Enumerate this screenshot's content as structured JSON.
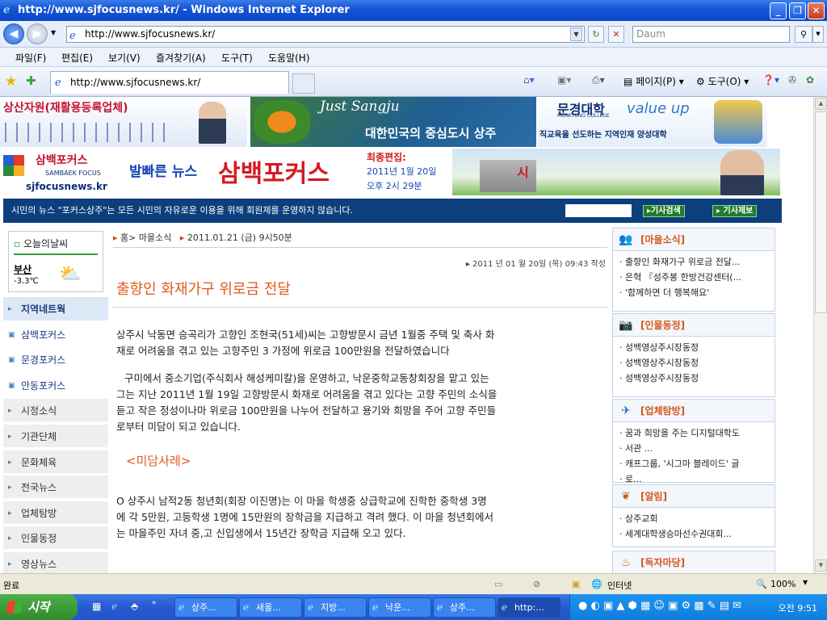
{
  "window": {
    "title": "http://www.sjfocusnews.kr/ - Windows Internet Explorer"
  },
  "address": {
    "url": "http://www.sjfocusnews.kr/",
    "search_placeholder": "Daum"
  },
  "menu": [
    "파일(F)",
    "편집(E)",
    "보기(V)",
    "즐겨찾기(A)",
    "도구(T)",
    "도움말(H)"
  ],
  "tab": {
    "label": "http://www.sjfocusnews.kr/"
  },
  "commands": {
    "page": "페이지(P)",
    "tools": "도구(O)"
  },
  "banners": {
    "ad1": "상산자원(재활용등록업체)",
    "ad2_title": "Just Sangju",
    "ad2_sub": "대한민국의 중심도시 상주",
    "ad3_school": "문경대학",
    "ad3_school_en": "MUNKYUNG COLLEGE",
    "ad3_slogan": "value up",
    "ad3_tagline": "직교육을 선도하는 지역인재 양성대학"
  },
  "header": {
    "logo_kr": "삼백포커스",
    "logo_en": "SAMBAEK FOCUS",
    "logo_url": "sjfocusnews.kr",
    "slogan_small": "발빠른 뉴스",
    "slogan_big": "삼백포커스",
    "edited_label": "최종편집:",
    "edited_date": "2011년 1월 20일",
    "edited_time": "오후 2시 29분",
    "image_caption": "시"
  },
  "notice": {
    "text": "시민의 뉴스 \"포커스상주\"는 모든 시민의 자유로운 이용을 위해 회원제를 운영하지 않습니다.",
    "search_button": "기사검색",
    "report_button": "기사제보"
  },
  "weather": {
    "title": "오늘의날씨",
    "city": "부산",
    "temp": "-3.3℃"
  },
  "left_nav": [
    {
      "label": "지역네트웍",
      "style": "blue"
    },
    {
      "label": "삼백포커스",
      "style": "sub"
    },
    {
      "label": "문경포커스",
      "style": "sub"
    },
    {
      "label": "안동포커스",
      "style": "sub"
    },
    {
      "label": "시정소식",
      "style": "gray"
    },
    {
      "label": "기관단체",
      "style": "gray"
    },
    {
      "label": "문화체육",
      "style": "gray"
    },
    {
      "label": "전국뉴스",
      "style": "gray"
    },
    {
      "label": "업체탐방",
      "style": "gray"
    },
    {
      "label": "인물동정",
      "style": "gray"
    },
    {
      "label": "영상뉴스",
      "style": "gray"
    }
  ],
  "article": {
    "breadcrumb": "홈> 마을소식",
    "breadcrumb_date": "2011.01.21 (금) 9시50분",
    "written": "2011 년 01 월 20일 (목) 09:43 작성",
    "title": "출향인 화재가구 위로금 전달",
    "p1_l1": "상주시 낙동면 승곡리가 고향인 조현국(51세)씨는 고향방문시 금년 1월중 주택 및 축사 화",
    "p1_l2": "재로 어려움을 겪고 있는 고향주민 3 가정에 위로금 100만원을 전달하였습니다",
    "p2_l1": "구미에서 중소기업(주식회사 해성케미칼)을 운영하고, 낙운중학교동창회장을 맡고 있는",
    "p2_l2": "그는 지난 2011년 1월 19일 고향방문시 화재로 어려움을 겪고 있다는 고향 주민의 소식을",
    "p2_l3": "듣고 작은 정성이나마 위로금 100만원을 나누어 전달하고 용기와 희망을 주어 고향 주민들",
    "p2_l4": "로부터 미담이 되고 있습니다.",
    "subhead": "<미담사례>",
    "p3_l1": "O 상주시 남적2동 청년회(회장 이진명)는 이 마을 학생중 상급학교에 진학한 중학생 3명",
    "p3_l2": "에 각 5만원, 고등학생 1명에 15만원의 장학금을 지급하고 격려 했다. 이 마을 청년회에서",
    "p3_l3": "는 마을주민 자녀 중,고 신입생에서 15년간 장학금 지급해 오고 있다."
  },
  "right": {
    "village": {
      "title": "[마을소식]",
      "items": [
        "출향인 화재가구 위로금 전달...",
        "은혁 『성주봉 한방건강센터(...",
        "'함께하면 더 행복해요'"
      ]
    },
    "people": {
      "title": "[인물동정]",
      "items": [
        "성백영상주시장동정",
        "성백영상주시장동정",
        "성백영상주시장동정"
      ]
    },
    "company": {
      "title": "[업체탐방]",
      "items": [
        "꿈과 희망을 주는 디지털대학도",
        "서관 ...",
        "캐프그룹, '시그마 블레이드' 글",
        "로..."
      ]
    },
    "notice": {
      "title": "[알림]",
      "items": [
        "상주교회",
        "세계대학생승마선수권대회..."
      ]
    },
    "reader": {
      "title": "[독자마당]"
    }
  },
  "status": {
    "left": "완료",
    "zone": "인터넷",
    "zoom": "100%"
  },
  "taskbar": {
    "start": "시작",
    "tasks": [
      "상주...",
      "새올...",
      "지방...",
      "낙운...",
      "상주...",
      "http:..."
    ],
    "clock": "오전 9:51"
  }
}
